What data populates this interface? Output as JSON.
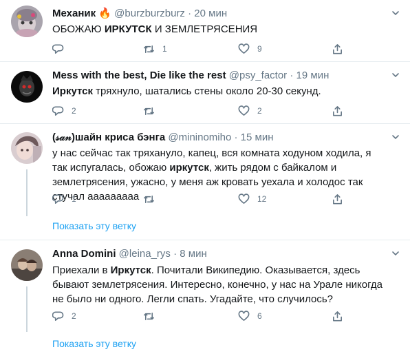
{
  "tweets": [
    {
      "name": "Механик",
      "handle": "@burzburzburz",
      "sep": "·",
      "time": "20 мин",
      "text": [
        {
          "t": "ОБОЖАЮ ",
          "b": false
        },
        {
          "t": "ИРКУТСК",
          "b": true
        },
        {
          "t": " И ЗЕМЛЕТРЯСЕНИЯ",
          "b": false
        }
      ],
      "reply_count": "",
      "retweet_count": "1",
      "like_count": "9",
      "thread_link": ""
    },
    {
      "name": "Mess with the best, Die like the rest",
      "handle": "@psy_factor",
      "sep": "·",
      "time": "19 мин",
      "text": [
        {
          "t": "Иркутск",
          "b": true
        },
        {
          "t": " тряхнуло, шатались стены около 20-30 секунд.",
          "b": false
        }
      ],
      "reply_count": "2",
      "retweet_count": "",
      "like_count": "2",
      "thread_link": ""
    },
    {
      "name": "(𝓈𝒶𝓃)шайн криса бэнга",
      "handle": "@mininomiho",
      "sep": "·",
      "time": "15 мин",
      "text": [
        {
          "t": "у нас сейчас так тряхануло, капец, вся комната ходуном ходила, я так испугалась, обожаю ",
          "b": false
        },
        {
          "t": "иркутск",
          "b": true
        },
        {
          "t": ", жить рядом с байкалом и землетрясения, ужасно, у меня аж кровать уехала и холодос так стучал ааааааааа",
          "b": false
        }
      ],
      "reply_count": "1",
      "retweet_count": "",
      "like_count": "12",
      "thread_link": "Показать эту ветку"
    },
    {
      "name": "Anna Domini",
      "handle": "@leina_rys",
      "sep": "·",
      "time": "8 мин",
      "text": [
        {
          "t": "Приехали в ",
          "b": false
        },
        {
          "t": "Иркутск",
          "b": true
        },
        {
          "t": ". Почитали Википедию. Оказывается, здесь бывают землетрясения. Интересно, конечно, у нас на Урале никогда не было ни одного. Легли спать. Угадайте, что случилось?",
          "b": false
        }
      ],
      "reply_count": "2",
      "retweet_count": "",
      "like_count": "6",
      "thread_link": "Показать эту ветку"
    }
  ],
  "icons": {
    "reply": "reply-icon",
    "retweet": "retweet-icon",
    "like": "heart-icon",
    "share": "share-icon",
    "more": "chevron-down-icon"
  },
  "colors": {
    "link": "#1da1f2",
    "muted": "#657786",
    "text": "#14171a",
    "divider": "#e6ecf0"
  }
}
